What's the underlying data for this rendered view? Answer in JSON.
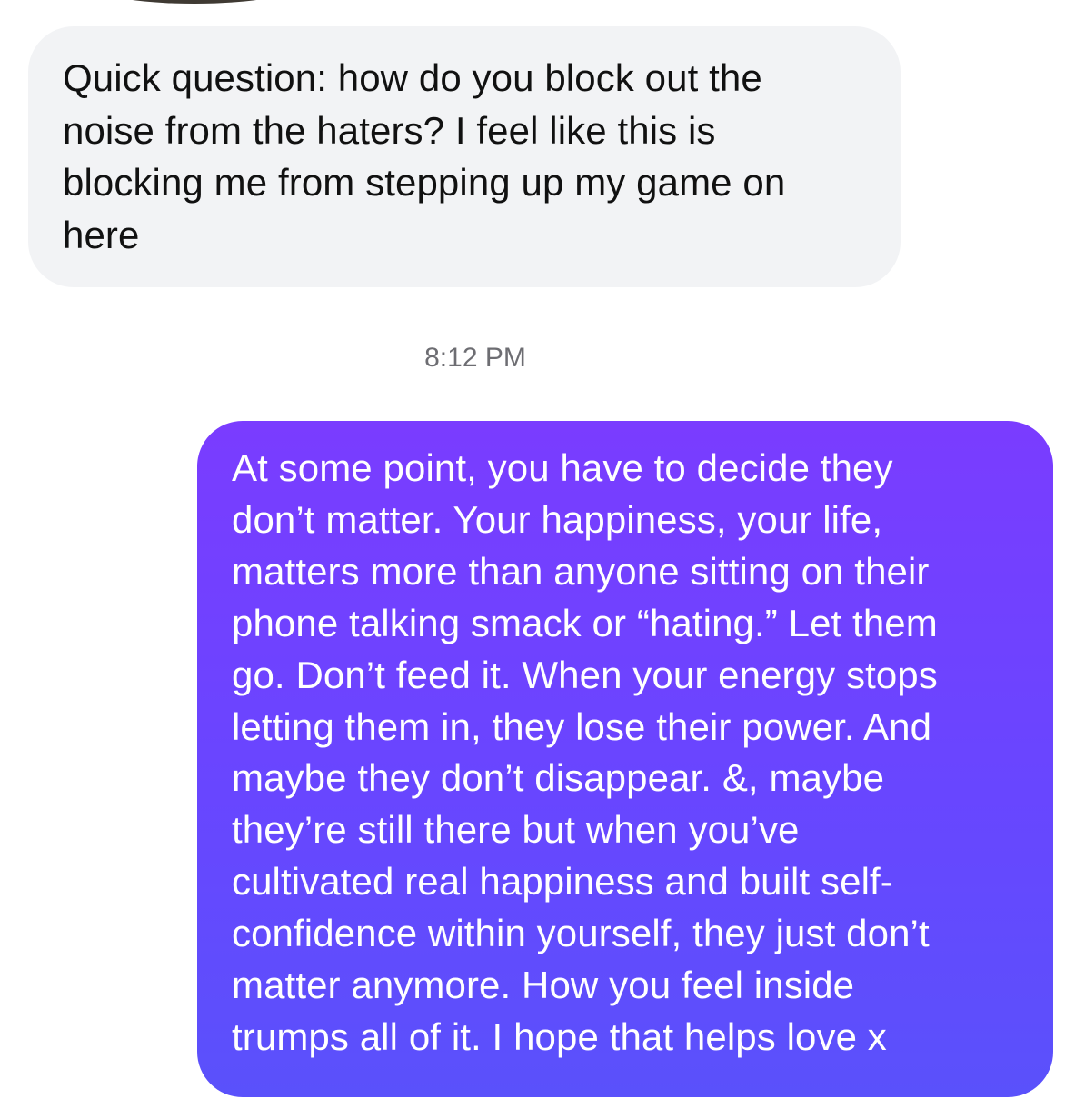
{
  "conversation": {
    "incoming_message": "Quick question: how do you block out the\nnoise from the haters? I feel like this is\nblocking me from stepping up my game on\nhere",
    "timestamp": "8:12 PM",
    "outgoing_message": "At some point, you have to decide they\ndon’t matter. Your happiness, your life,\nmatters more than anyone sitting on their\nphone talking smack or “hating.” Let them\ngo. Don’t feed it. When your energy stops\nletting them in, they lose their power. And\nmaybe they don’t disappear. &, maybe\nthey’re still there but when you’ve\ncultivated real happiness and built self-\nconfidence within yourself, they just don’t\nmatter anymore. How you feel inside\ntrumps all of it. I hope that helps love x"
  },
  "colors": {
    "incoming_bubble": "#f2f3f5",
    "outgoing_gradient_top": "#7a3cff",
    "outgoing_gradient_bottom": "#5a51fb",
    "timestamp_text": "#6d6d72"
  },
  "icons": {
    "avatar": "avatar"
  }
}
